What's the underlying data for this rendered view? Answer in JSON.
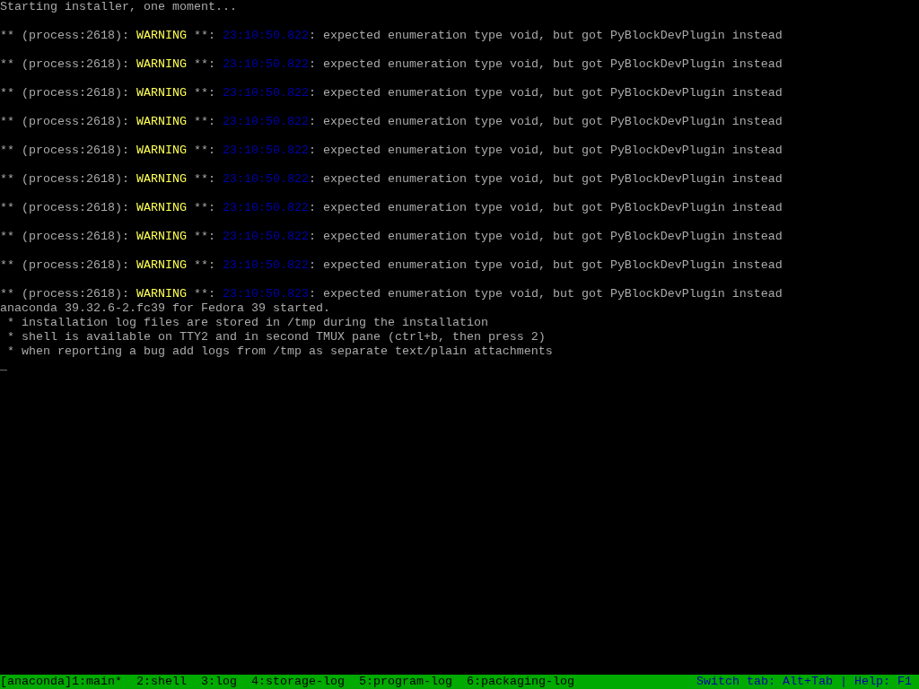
{
  "lines": [
    {
      "kind": "text",
      "text": "Starting installer, one moment..."
    },
    {
      "kind": "warning",
      "prefix": "** (process:2618):",
      "level": "WARNING",
      "marker": "**:",
      "timestamp": "23:10:50.822",
      "message": ": expected enumeration type void, but got PyBlockDevPlugin instead"
    },
    {
      "kind": "warning",
      "prefix": "** (process:2618):",
      "level": "WARNING",
      "marker": "**:",
      "timestamp": "23:10:50.822",
      "message": ": expected enumeration type void, but got PyBlockDevPlugin instead"
    },
    {
      "kind": "warning",
      "prefix": "** (process:2618):",
      "level": "WARNING",
      "marker": "**:",
      "timestamp": "23:10:50.822",
      "message": ": expected enumeration type void, but got PyBlockDevPlugin instead"
    },
    {
      "kind": "warning",
      "prefix": "** (process:2618):",
      "level": "WARNING",
      "marker": "**:",
      "timestamp": "23:10:50.822",
      "message": ": expected enumeration type void, but got PyBlockDevPlugin instead"
    },
    {
      "kind": "warning",
      "prefix": "** (process:2618):",
      "level": "WARNING",
      "marker": "**:",
      "timestamp": "23:10:50.822",
      "message": ": expected enumeration type void, but got PyBlockDevPlugin instead"
    },
    {
      "kind": "warning",
      "prefix": "** (process:2618):",
      "level": "WARNING",
      "marker": "**:",
      "timestamp": "23:10:50.822",
      "message": ": expected enumeration type void, but got PyBlockDevPlugin instead"
    },
    {
      "kind": "warning",
      "prefix": "** (process:2618):",
      "level": "WARNING",
      "marker": "**:",
      "timestamp": "23:10:50.822",
      "message": ": expected enumeration type void, but got PyBlockDevPlugin instead"
    },
    {
      "kind": "warning",
      "prefix": "** (process:2618):",
      "level": "WARNING",
      "marker": "**:",
      "timestamp": "23:10:50.822",
      "message": ": expected enumeration type void, but got PyBlockDevPlugin instead"
    },
    {
      "kind": "warning",
      "prefix": "** (process:2618):",
      "level": "WARNING",
      "marker": "**:",
      "timestamp": "23:10:50.822",
      "message": ": expected enumeration type void, but got PyBlockDevPlugin instead"
    },
    {
      "kind": "warning",
      "prefix": "** (process:2618):",
      "level": "WARNING",
      "marker": "**:",
      "timestamp": "23:10:50.823",
      "message": ": expected enumeration type void, but got PyBlockDevPlugin instead"
    },
    {
      "kind": "text",
      "text": "anaconda 39.32.6-2.fc39 for Fedora 39 started."
    },
    {
      "kind": "text",
      "text": " * installation log files are stored in /tmp during the installation"
    },
    {
      "kind": "text",
      "text": " * shell is available on TTY2 and in second TMUX pane (ctrl+b, then press 2)"
    },
    {
      "kind": "text",
      "text": " * when reporting a bug add logs from /tmp as separate text/plain attachments"
    },
    {
      "kind": "cursor",
      "text": "_"
    }
  ],
  "status_bar": {
    "session": "[anaconda]",
    "windows": [
      "1:main*",
      "2:shell",
      "3:log",
      "4:storage-log",
      "5:program-log",
      "6:packaging-log"
    ],
    "hint": "Switch tab: Alt+Tab | Help: F1"
  }
}
